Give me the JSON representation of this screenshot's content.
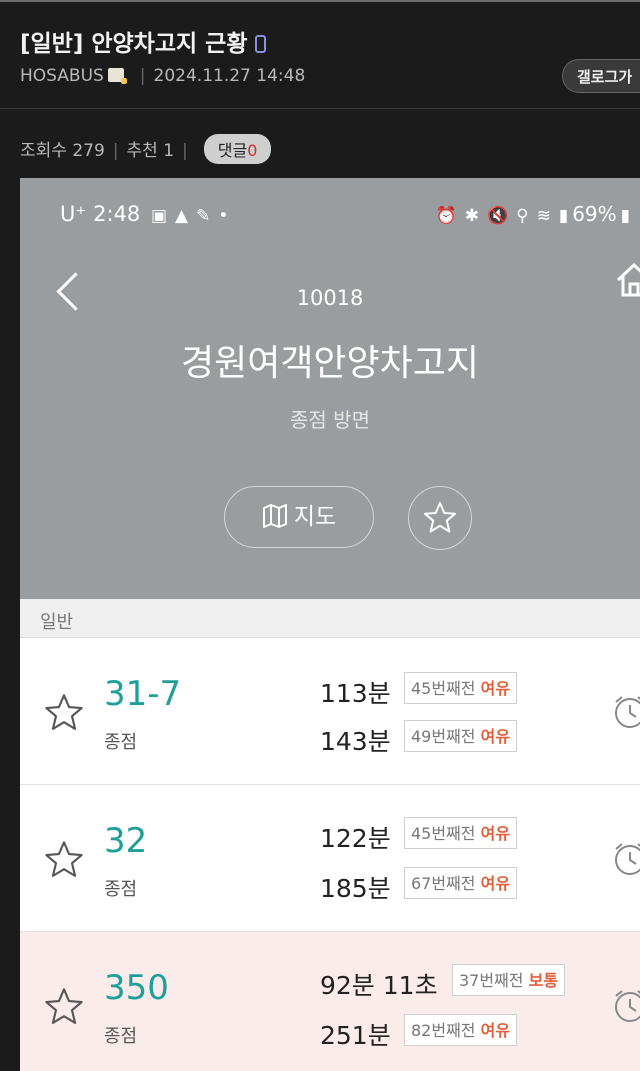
{
  "post": {
    "title": "[일반] 안양차고지 근황",
    "author": "HOSABUS",
    "datetime": "2024.11.27 14:48",
    "gallog_label": "갤로그가",
    "views_label": "조회수 279",
    "recommend_label": "추천 1",
    "comments_label": "댓글",
    "comments_count": "0"
  },
  "screenshot": {
    "status_bar": {
      "carrier_time": "U⁺ 2:48",
      "battery": "69%"
    },
    "stop": {
      "number": "10018",
      "name": "경원여객안양차고지",
      "direction": "종점 방면",
      "map_label": "지도"
    },
    "section_label": "일반",
    "routes": [
      {
        "number": "31-7",
        "destination": "종점",
        "arrivals": [
          {
            "time": "113분",
            "stops_before": "45번째전",
            "level": "여유"
          },
          {
            "time": "143분",
            "stops_before": "49번째전",
            "level": "여유"
          }
        ]
      },
      {
        "number": "32",
        "destination": "종점",
        "arrivals": [
          {
            "time": "122분",
            "stops_before": "45번째전",
            "level": "여유"
          },
          {
            "time": "185분",
            "stops_before": "67번째전",
            "level": "여유"
          }
        ]
      },
      {
        "number": "350",
        "destination": "종점",
        "arrivals": [
          {
            "time": "92분 11초",
            "stops_before": "37번째전",
            "level": "보통"
          },
          {
            "time": "251분",
            "stops_before": "82번째전",
            "level": "여유"
          }
        ]
      }
    ]
  },
  "colors": {
    "route_number": "#1f9f9a",
    "level_text": "#e0603c",
    "header_bg": "#9a9d9f",
    "highlight_row_bg": "#fbecec"
  },
  "icons": {
    "back": "chevron-left-icon",
    "home": "home-icon",
    "map": "map-icon",
    "favorite": "star-icon",
    "alarm": "alarm-clock-icon"
  }
}
